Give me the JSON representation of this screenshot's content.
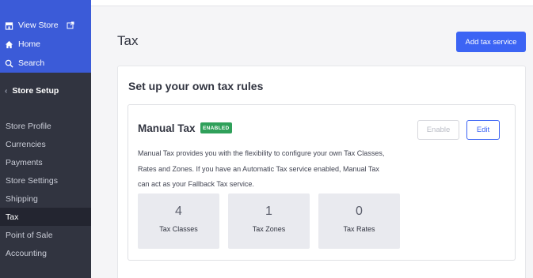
{
  "sidebar": {
    "top_items": [
      {
        "label": "View Store",
        "icon": "storefront-icon"
      },
      {
        "label": "Home",
        "icon": "home-icon"
      },
      {
        "label": "Search",
        "icon": "search-icon"
      }
    ],
    "section": {
      "label": "Store Setup",
      "icon": "chevron-left-icon"
    },
    "sub_items": [
      {
        "label": "Store Profile",
        "active": false
      },
      {
        "label": "Currencies",
        "active": false
      },
      {
        "label": "Payments",
        "active": false
      },
      {
        "label": "Store Settings",
        "active": false
      },
      {
        "label": "Shipping",
        "active": false
      },
      {
        "label": "Tax",
        "active": true
      },
      {
        "label": "Point of Sale",
        "active": false
      },
      {
        "label": "Accounting",
        "active": false
      }
    ]
  },
  "header": {
    "title": "Tax",
    "add_button_label": "Add tax service"
  },
  "panel": {
    "title": "Set up your own tax rules",
    "card": {
      "title": "Manual Tax",
      "badge": "ENABLED",
      "enable_label": "Enable",
      "edit_label": "Edit",
      "description_lines": [
        "Manual Tax provides you with the flexibility to configure your own Tax Classes,",
        "Rates and Zones. If you have an Automatic Tax service enabled, Manual Tax",
        "can act as your Fallback Tax service."
      ],
      "stats": [
        {
          "value": "4",
          "label": "Tax Classes"
        },
        {
          "value": "1",
          "label": "Tax Zones"
        },
        {
          "value": "0",
          "label": "Tax Rates"
        }
      ]
    }
  },
  "colors": {
    "sidebar_bg": "#313440",
    "sidebar_top_bg": "#3b5bd8",
    "accent": "#3c64f4",
    "badge_green": "#2fa05a"
  }
}
